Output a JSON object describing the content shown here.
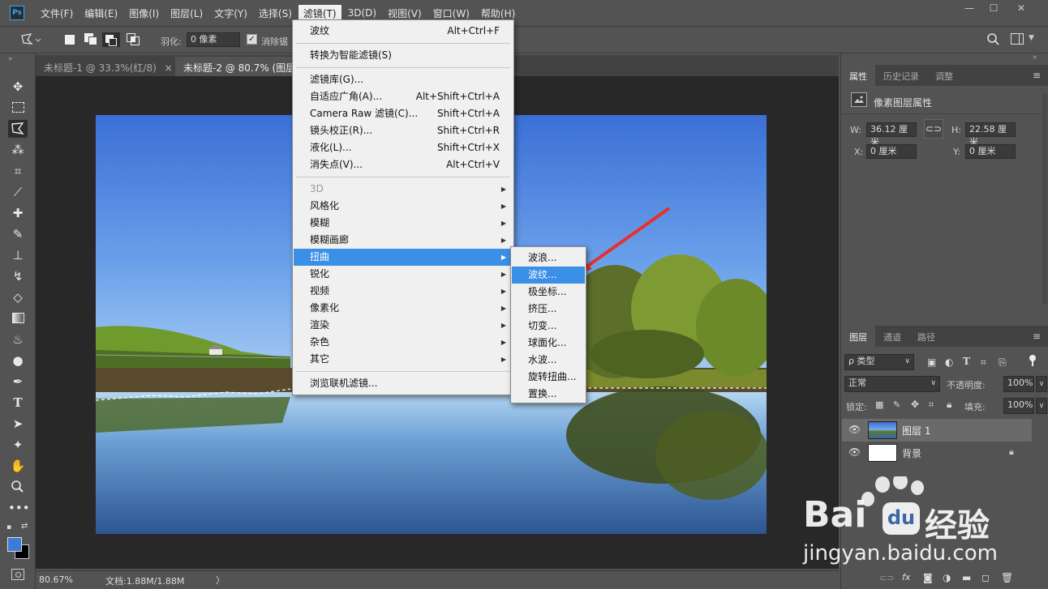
{
  "app": {
    "logo": "Ps"
  },
  "menubar": {
    "items": [
      "文件(F)",
      "编辑(E)",
      "图像(I)",
      "图层(L)",
      "文字(Y)",
      "选择(S)",
      "滤镜(T)",
      "3D(D)",
      "视图(V)",
      "窗口(W)",
      "帮助(H)"
    ],
    "active": "滤镜(T)",
    "window_controls": [
      "—",
      "☐",
      "✕"
    ]
  },
  "options": {
    "feather_label": "羽化:",
    "feather_value": "0 像素",
    "antialias_label": "消除锯"
  },
  "tabs": [
    {
      "label": "未标题-1 @ 33.3%(红/8)",
      "close": "×",
      "active": false
    },
    {
      "label": "未标题-2 @ 80.7% (图层",
      "active": true
    }
  ],
  "filter_menu": {
    "items": [
      {
        "label": "波纹",
        "shortcut": "Alt+Ctrl+F"
      },
      {
        "sep": true
      },
      {
        "label": "转换为智能滤镜(S)"
      },
      {
        "sep": true
      },
      {
        "label": "滤镜库(G)..."
      },
      {
        "label": "自适应广角(A)...",
        "shortcut": "Alt+Shift+Ctrl+A"
      },
      {
        "label": "Camera Raw 滤镜(C)...",
        "shortcut": "Shift+Ctrl+A"
      },
      {
        "label": "镜头校正(R)...",
        "shortcut": "Shift+Ctrl+R"
      },
      {
        "label": "液化(L)...",
        "shortcut": "Shift+Ctrl+X"
      },
      {
        "label": "消失点(V)...",
        "shortcut": "Alt+Ctrl+V"
      },
      {
        "sep": true
      },
      {
        "label": "3D",
        "submenu": true,
        "disabled": true
      },
      {
        "label": "风格化",
        "submenu": true
      },
      {
        "label": "模糊",
        "submenu": true
      },
      {
        "label": "模糊画廊",
        "submenu": true
      },
      {
        "label": "扭曲",
        "submenu": true,
        "highlighted": true
      },
      {
        "label": "锐化",
        "submenu": true
      },
      {
        "label": "视频",
        "submenu": true
      },
      {
        "label": "像素化",
        "submenu": true
      },
      {
        "label": "渲染",
        "submenu": true
      },
      {
        "label": "杂色",
        "submenu": true
      },
      {
        "label": "其它",
        "submenu": true
      },
      {
        "sep": true
      },
      {
        "label": "浏览联机滤镜..."
      }
    ]
  },
  "distort_submenu": {
    "items": [
      {
        "label": "波浪..."
      },
      {
        "label": "波纹...",
        "highlighted": true
      },
      {
        "label": "极坐标..."
      },
      {
        "label": "挤压..."
      },
      {
        "label": "切变..."
      },
      {
        "label": "球面化..."
      },
      {
        "label": "水波..."
      },
      {
        "label": "旋转扭曲..."
      },
      {
        "label": "置换..."
      }
    ]
  },
  "status": {
    "zoom": "80.67%",
    "doc": "文档:1.88M/1.88M",
    "arrow": "〉"
  },
  "properties": {
    "tabs": [
      "属性",
      "历史记录",
      "调整"
    ],
    "title": "像素图层属性",
    "w_label": "W:",
    "w_value": "36.12 厘米",
    "h_label": "H:",
    "h_value": "22.58 厘米",
    "x_label": "X:",
    "x_value": "0 厘米",
    "y_label": "Y:",
    "y_value": "0 厘米"
  },
  "layers": {
    "tabs": [
      "图层",
      "通道",
      "路径"
    ],
    "filter_kind": "ρ 类型",
    "blend_mode": "正常",
    "opacity_label": "不透明度:",
    "opacity_value": "100%",
    "lock_label": "锁定:",
    "fill_label": "填充:",
    "fill_value": "100%",
    "list": [
      {
        "name": "图层 1",
        "selected": true
      },
      {
        "name": "背景",
        "locked": true
      }
    ]
  },
  "watermark": {
    "brand_left": "Bai",
    "brand_right": "经验",
    "url": "jingyan.baidu.com"
  },
  "colors": {
    "accent": "#3a8fe6",
    "arrow_red": "#e8302a",
    "foreground_swatch": "#3d7bd9",
    "background_swatch": "#000000"
  }
}
